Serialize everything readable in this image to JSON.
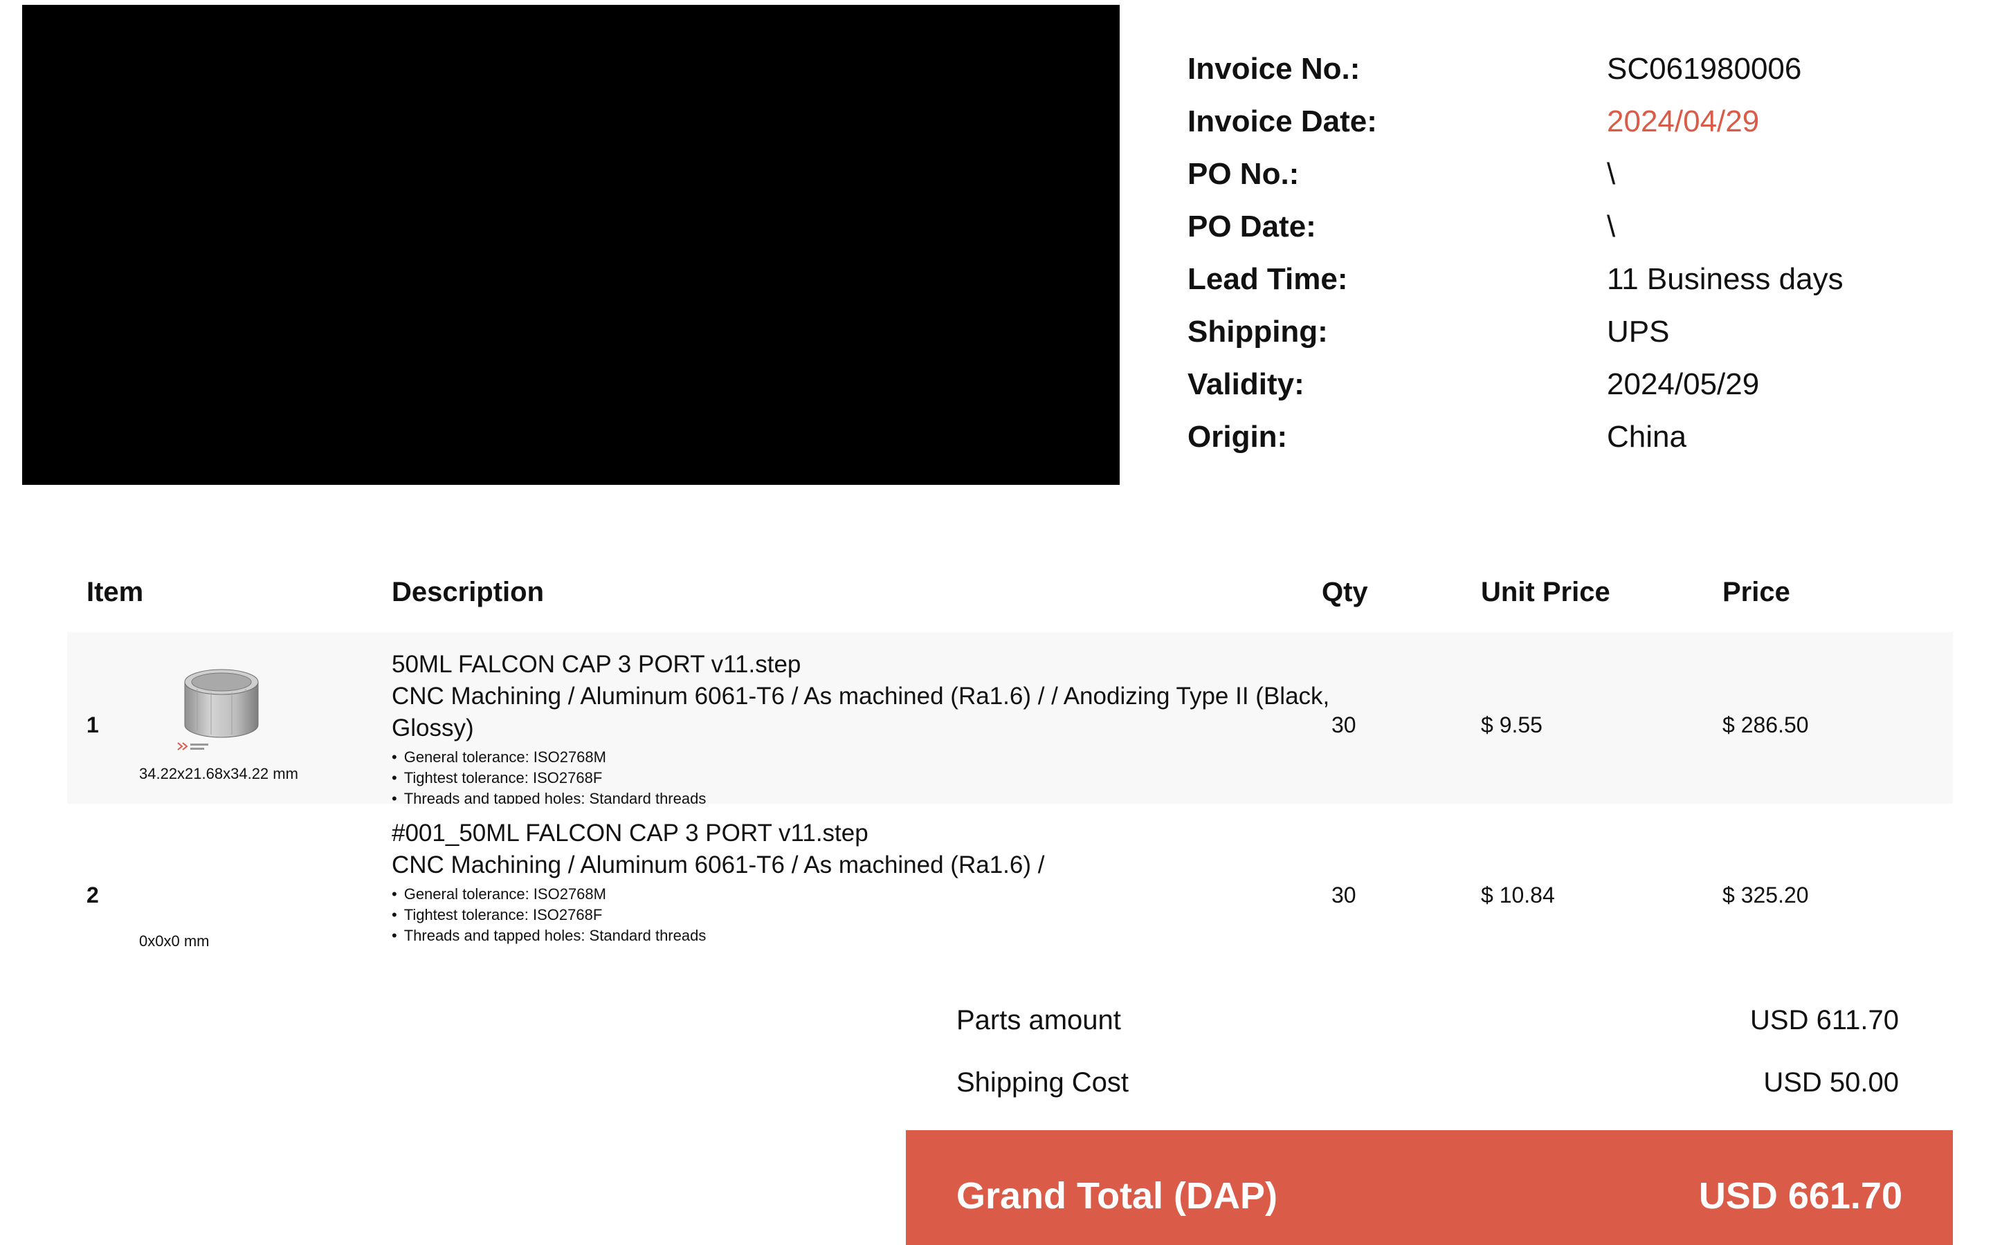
{
  "invoice": {
    "rows": [
      {
        "label": "Invoice No.:",
        "value": "SC061980006"
      },
      {
        "label": "Invoice Date:",
        "value": "2024/04/29"
      },
      {
        "label": "PO No.:",
        "value": "\\"
      },
      {
        "label": "PO Date:",
        "value": "\\"
      },
      {
        "label": "Lead Time:",
        "value": "11 Business days"
      },
      {
        "label": "Shipping:",
        "value": "UPS"
      },
      {
        "label": "Validity:",
        "value": "2024/05/29"
      },
      {
        "label": "Origin:",
        "value": "China"
      }
    ]
  },
  "table": {
    "headers": {
      "item": "Item",
      "description": "Description",
      "qty": "Qty",
      "unit_price": "Unit Price",
      "price": "Price"
    },
    "rows": [
      {
        "item": "1",
        "dims": "34.22x21.68x34.22 mm",
        "filename": "50ML FALCON CAP 3 PORT v11.step",
        "process": "CNC Machining / Aluminum 6061-T6 / As machined (Ra1.6) /  / Anodizing Type II (Black, Glossy)",
        "notes": [
          "General tolerance: ISO2768M",
          "Tightest tolerance: ISO2768F",
          "Threads and tapped holes: Standard threads"
        ],
        "qty": "30",
        "unit_price": "$ 9.55",
        "price": "$ 286.50"
      },
      {
        "item": "2",
        "dims": "0x0x0 mm",
        "filename": "#001_50ML FALCON CAP 3 PORT v11.step",
        "process": "CNC Machining / Aluminum 6061-T6 / As machined (Ra1.6) /",
        "notes": [
          "General tolerance: ISO2768M",
          "Tightest tolerance: ISO2768F",
          "Threads and tapped holes: Standard threads"
        ],
        "qty": "30",
        "unit_price": "$ 10.84",
        "price": "$ 325.20"
      }
    ]
  },
  "summary": {
    "parts_label": "Parts amount",
    "parts_value": "USD 611.70",
    "shipping_label": "Shipping Cost",
    "shipping_value": "USD 50.00",
    "grand_label": "Grand Total (DAP)",
    "grand_value": "USD 661.70"
  },
  "colors": {
    "accent": "#d95b48",
    "row_shade": "#f8f8f8"
  }
}
